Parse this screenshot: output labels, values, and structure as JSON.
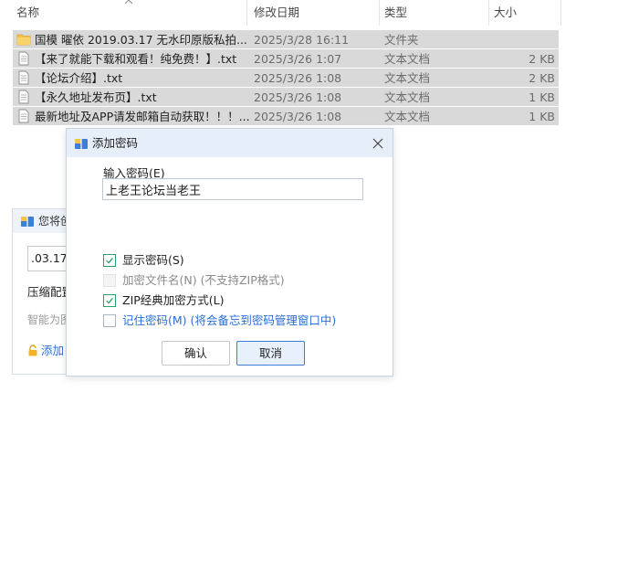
{
  "file_list": {
    "columns": {
      "name": "名称",
      "date": "修改日期",
      "type": "类型",
      "size": "大小"
    },
    "rows": [
      {
        "icon": "folder-icon",
        "name": "国模 曜依 2019.03.17 无水印原版私拍...",
        "date": "2025/3/28 16:11",
        "type": "文件夹",
        "size": ""
      },
      {
        "icon": "text-file-icon",
        "name": "【来了就能下载和观看！纯免费！】.txt",
        "date": "2025/3/26 1:07",
        "type": "文本文档",
        "size": "2 KB"
      },
      {
        "icon": "text-file-icon",
        "name": "【论坛介绍】.txt",
        "date": "2025/3/26 1:08",
        "type": "文本文档",
        "size": "2 KB"
      },
      {
        "icon": "text-file-icon",
        "name": "【永久地址发布页】.txt",
        "date": "2025/3/26 1:08",
        "type": "文本文档",
        "size": "1 KB"
      },
      {
        "icon": "text-file-icon",
        "name": "最新地址及APP请发邮箱自动获取！！！....",
        "date": "2025/3/26 1:08",
        "type": "文本文档",
        "size": "1 KB"
      }
    ]
  },
  "compress_dialog": {
    "title": "您将创",
    "filename_value": ".03.17 ",
    "config_label": "压缩配置",
    "smart_label": "智能为图",
    "add_password_label": "添加"
  },
  "password_dialog": {
    "title": "添加密码",
    "field_label": "输入密码(E)",
    "password_value": "上老王论坛当老王",
    "options": {
      "show_password": {
        "label": "显示密码(S)",
        "checked": true
      },
      "encrypt_filenames": {
        "label": "加密文件名(N) (不支持ZIP格式)",
        "checked": false,
        "disabled": true
      },
      "zip_classic": {
        "label": "ZIP经典加密方式(L)",
        "checked": true
      },
      "remember_password": {
        "label": "记住密码(M) (将会备忘到密码管理窗口中)",
        "checked": false
      }
    },
    "ok_label": "确认",
    "cancel_label": "取消"
  },
  "colors": {
    "accent": "#2a6fd6",
    "check": "#2aa36b",
    "row_selected": "#d9d9d9"
  }
}
